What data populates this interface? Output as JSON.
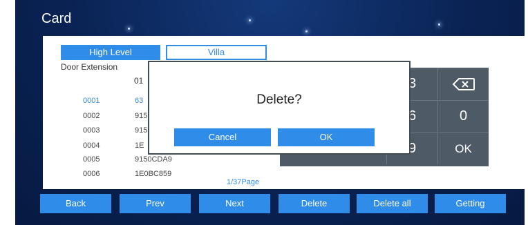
{
  "header": {
    "title": "Card"
  },
  "tabs": [
    {
      "label": "High Level",
      "active": true
    },
    {
      "label": "Villa",
      "active": false
    }
  ],
  "list": {
    "column_label": "Door Extension",
    "column_value": "01",
    "rows": [
      {
        "index": "0001",
        "code": "63",
        "selected": true
      },
      {
        "index": "0002",
        "code": "915",
        "selected": false
      },
      {
        "index": "0003",
        "code": "915",
        "selected": false
      },
      {
        "index": "0004",
        "code": "1E",
        "selected": false
      },
      {
        "index": "0005",
        "code": "9150CDA9",
        "selected": false
      },
      {
        "index": "0006",
        "code": "1E0BC859",
        "selected": false
      }
    ],
    "page_indicator": "1/37Page"
  },
  "keypad": {
    "keys": [
      "3",
      "backspace",
      "6",
      "0",
      "9",
      "OK"
    ]
  },
  "dialog": {
    "message": "Delete?",
    "cancel_label": "Cancel",
    "ok_label": "OK"
  },
  "bottom_bar": {
    "buttons": [
      "Back",
      "Prev",
      "Next",
      "Delete",
      "Delete all",
      "Getting"
    ]
  },
  "colors": {
    "accent": "#2f8ce8",
    "background": "#0a2354",
    "keypad": "#4e5a66"
  }
}
